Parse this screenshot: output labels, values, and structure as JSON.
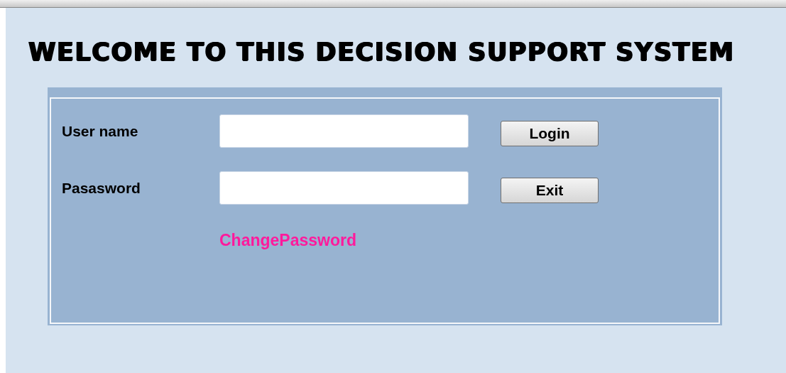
{
  "title": "WELCOME TO THIS DECISION SUPPORT SYSTEM",
  "fields": [
    {
      "label": "User name",
      "button": "Login"
    },
    {
      "label": "Pasasword",
      "button": "Exit"
    }
  ],
  "link": "ChangePassword"
}
